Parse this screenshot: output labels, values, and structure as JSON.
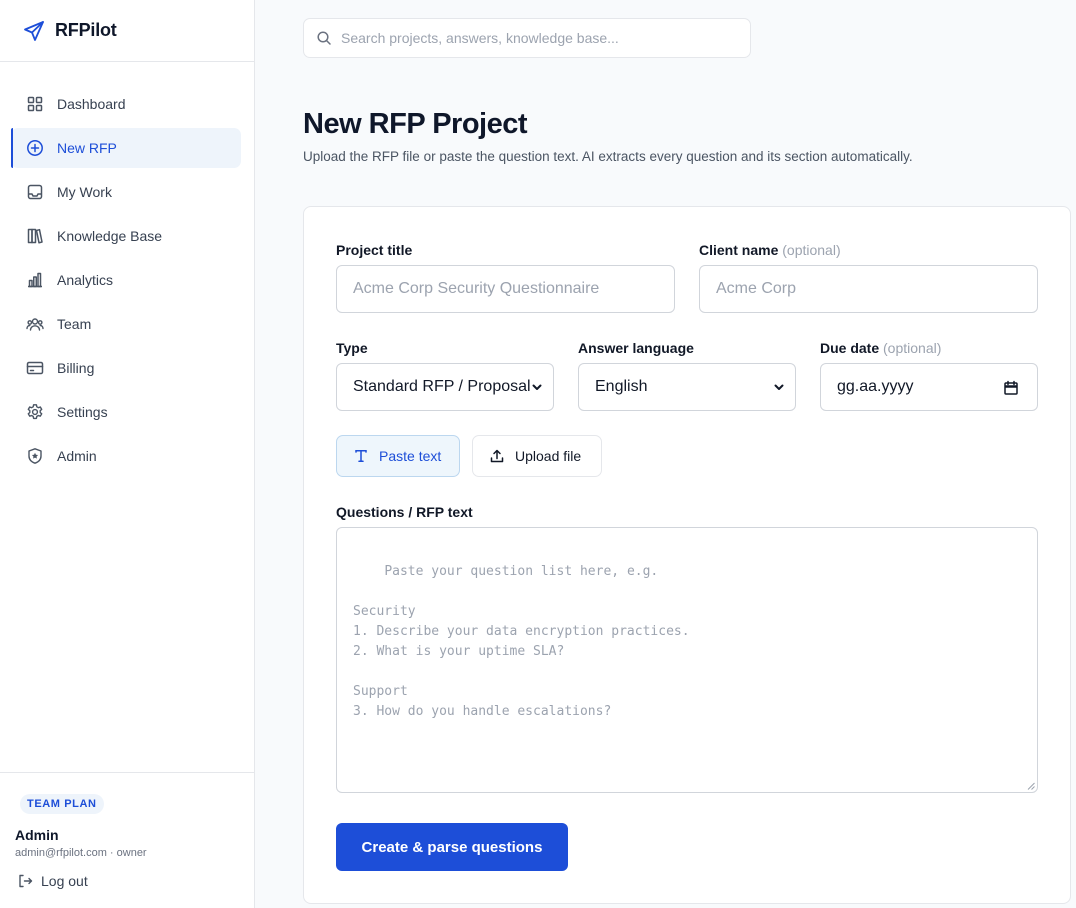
{
  "brand": {
    "name": "RFPilot",
    "icon": "paper-plane-icon",
    "accent": "#1d4ed8"
  },
  "sidebar": {
    "items": [
      {
        "label": "Dashboard",
        "icon": "grid-icon",
        "active": false
      },
      {
        "label": "New RFP",
        "icon": "plus-circle-icon",
        "active": true
      },
      {
        "label": "My Work",
        "icon": "inbox-icon",
        "active": false
      },
      {
        "label": "Knowledge Base",
        "icon": "books-icon",
        "active": false
      },
      {
        "label": "Analytics",
        "icon": "bar-chart-icon",
        "active": false
      },
      {
        "label": "Team",
        "icon": "users-icon",
        "active": false
      },
      {
        "label": "Billing",
        "icon": "credit-card-icon",
        "active": false
      },
      {
        "label": "Settings",
        "icon": "gear-icon",
        "active": false
      },
      {
        "label": "Admin",
        "icon": "shield-star-icon",
        "active": false
      }
    ],
    "plan": "TEAM PLAN",
    "user": {
      "name": "Admin",
      "meta": "admin@rfpilot.com · owner"
    },
    "logout": "Log out"
  },
  "search": {
    "placeholder": "Search projects, answers, knowledge base..."
  },
  "page": {
    "title": "New RFP Project",
    "subtitle": "Upload the RFP file or paste the question text. AI extracts every question and its section automatically."
  },
  "form": {
    "project_title": {
      "label": "Project title",
      "placeholder": "Acme Corp Security Questionnaire"
    },
    "client_name": {
      "label": "Client name",
      "optional": "(optional)",
      "placeholder": "Acme Corp"
    },
    "type": {
      "label": "Type",
      "value": "Standard RFP / Proposal"
    },
    "language": {
      "label": "Answer language",
      "value": "English"
    },
    "due_date": {
      "label": "Due date",
      "optional": "(optional)",
      "placeholder": "gg.aa.yyyy"
    },
    "modes": {
      "paste": "Paste text",
      "upload": "Upload file"
    },
    "questions": {
      "label": "Questions / RFP text",
      "placeholder": "Paste your question list here, e.g.\n\nSecurity\n1. Describe your data encryption practices.\n2. What is your uptime SLA?\n\nSupport\n3. How do you handle escalations?"
    },
    "submit": "Create & parse questions"
  }
}
